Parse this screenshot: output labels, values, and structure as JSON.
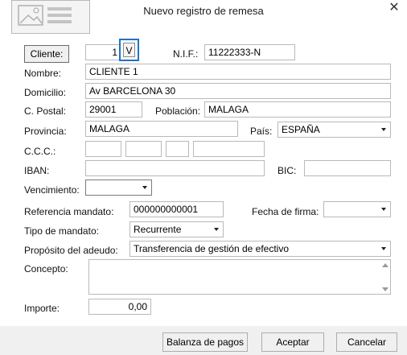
{
  "window": {
    "title": "Nuevo registro de remesa",
    "close_glyph": "✕"
  },
  "cliente": {
    "button_label": "Cliente:",
    "code": "1",
    "lookup_label": "V"
  },
  "nif": {
    "label": "N.I.F.:",
    "value": "11222333-N"
  },
  "nombre": {
    "label": "Nombre:",
    "value": "CLIENTE 1"
  },
  "domicilio": {
    "label": "Domicilio:",
    "value": "Av BARCELONA 30"
  },
  "cpostal": {
    "label": "C. Postal:",
    "value": "29001"
  },
  "poblacion": {
    "label": "Población:",
    "value": "MALAGA"
  },
  "provincia": {
    "label": "Provincia:",
    "value": "MALAGA"
  },
  "pais": {
    "label": "País:",
    "value": "ESPAÑA"
  },
  "ccc": {
    "label": "C.C.C.:",
    "entidad": "",
    "oficina": "",
    "dc": "",
    "cuenta": ""
  },
  "iban": {
    "label": "IBAN:",
    "value": ""
  },
  "bic": {
    "label": "BIC:",
    "value": ""
  },
  "vencimiento": {
    "label": "Vencimiento:",
    "value": ""
  },
  "referencia": {
    "label": "Referencia mandato:",
    "value": "000000000001"
  },
  "fecha_firma": {
    "label": "Fecha de firma:",
    "value": ""
  },
  "tipo_mandato": {
    "label": "Tipo de mandato:",
    "value": "Recurrente"
  },
  "proposito": {
    "label": "Propósito del adeudo:",
    "value": "Transferencia de gestión de efectivo"
  },
  "concepto": {
    "label": "Concepto:",
    "value": ""
  },
  "importe": {
    "label": "Importe:",
    "value": "0,00"
  },
  "footer": {
    "balanza_label": "Balanza de pagos",
    "aceptar_label": "Aceptar",
    "cancelar_label": "Cancelar"
  },
  "icons": {
    "header": "document-image-icon",
    "close": "close-icon",
    "dropdown": "chevron-down-icon"
  },
  "colors": {
    "focus_border": "#1e73c8",
    "footer_bg": "#f0f0f0"
  }
}
